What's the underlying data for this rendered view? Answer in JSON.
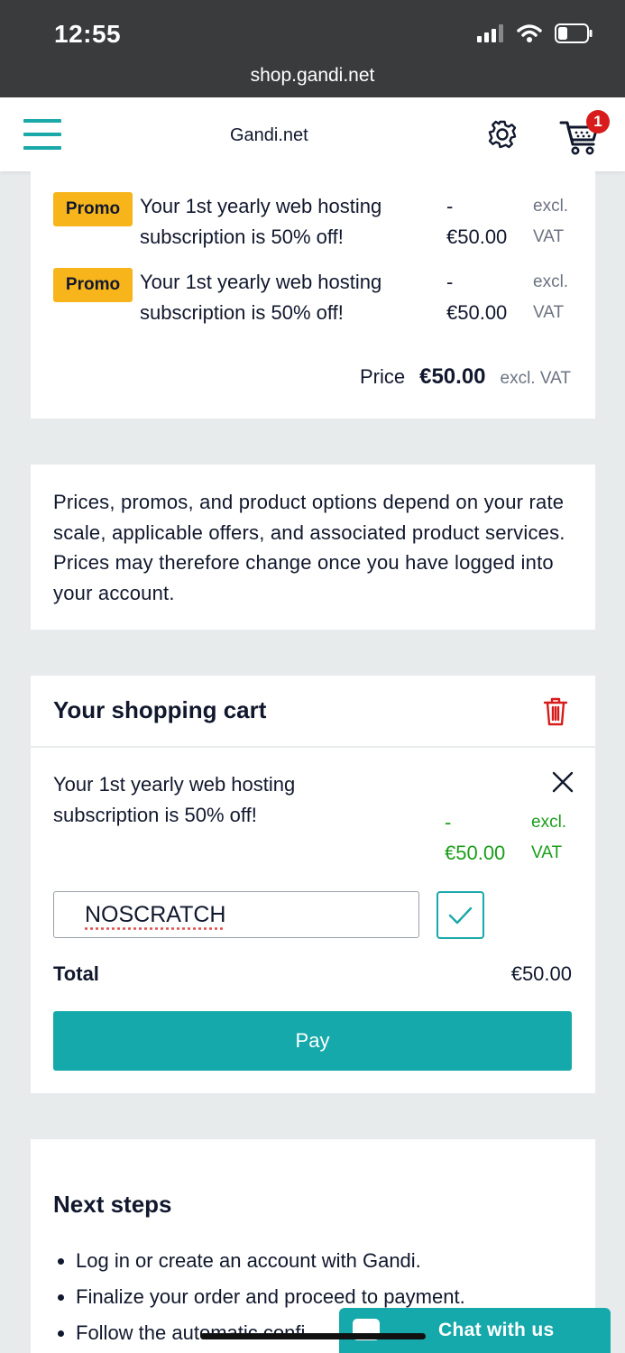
{
  "status_bar": {
    "time": "12:55",
    "url": "shop.gandi.net"
  },
  "nav": {
    "brand": "Gandi.net",
    "cart_count": "1"
  },
  "promos": [
    {
      "badge": "Promo",
      "text": "Your 1st yearly web hosting subscription is 50% off!",
      "amount_sign": "-",
      "amount": "€50.00",
      "vat_1": "excl.",
      "vat_2": "VAT"
    },
    {
      "badge": "Promo",
      "text": "Your 1st yearly web hosting subscription is 50% off!",
      "amount_sign": "-",
      "amount": "€50.00",
      "vat_1": "excl.",
      "vat_2": "VAT"
    }
  ],
  "price": {
    "label": "Price",
    "value": "€50.00",
    "vat": "excl. VAT"
  },
  "info": {
    "text": "Prices, promos, and product options depend on your rate scale, applicable offers, and associated product services. Prices may therefore change once you have logged into your account."
  },
  "cart": {
    "title": "Your shopping cart",
    "item_text": "Your 1st yearly web hosting subscription is 50% off!",
    "item_sign": "-",
    "item_amount": "€50.00",
    "item_vat_1": "excl.",
    "item_vat_2": "VAT",
    "coupon_value": "NOSCRATCH",
    "total_label": "Total",
    "total_value": "€50.00",
    "pay_label": "Pay"
  },
  "next_steps": {
    "title": "Next steps",
    "items": [
      "Log in or create an account with Gandi.",
      "Finalize your order and proceed to payment.",
      "Follow the automatic confi"
    ]
  },
  "chat": {
    "label": "Chat with us"
  },
  "colors": {
    "accent": "#16a9ab",
    "promo": "#f7b51b",
    "discount": "#1a9e1a",
    "danger": "#d81b1b"
  }
}
